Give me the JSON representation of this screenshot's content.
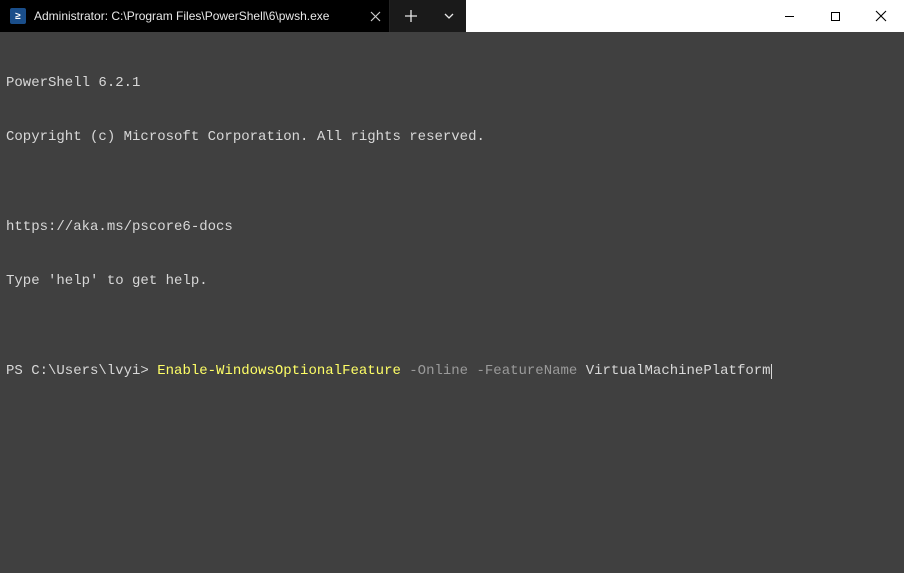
{
  "tab": {
    "title": "Administrator: C:\\Program Files\\PowerShell\\6\\pwsh.exe",
    "icon_char": "≥"
  },
  "terminal": {
    "line1": "PowerShell 6.2.1",
    "line2": "Copyright (c) Microsoft Corporation. All rights reserved.",
    "line3": "",
    "line4": "https://aka.ms/pscore6-docs",
    "line5": "Type 'help' to get help.",
    "line6": "",
    "prompt": "PS C:\\Users\\lvyi> ",
    "cmdlet": "Enable-WindowsOptionalFeature",
    "param1": " -Online ",
    "param2": "-FeatureName ",
    "arg": "VirtualMachinePlatform"
  }
}
